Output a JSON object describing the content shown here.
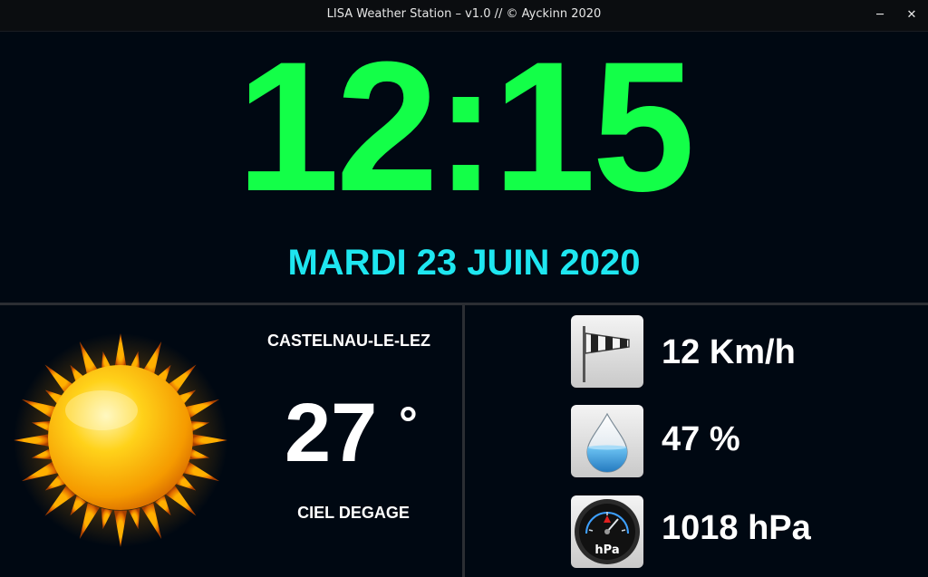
{
  "window": {
    "title": "LISA Weather Station – v1.0 // © Ayckinn 2020",
    "minimize_icon": "minimize-icon",
    "close_icon": "close-icon"
  },
  "clock": {
    "time": "12:15"
  },
  "date": {
    "text": "MARDI 23 JUIN 2020"
  },
  "weather": {
    "city": "CASTELNAU-LE-LEZ",
    "temperature": "27",
    "degree_symbol": "°",
    "condition": "CIEL DEGAGE",
    "icon": "sun-icon"
  },
  "metrics": {
    "wind": {
      "icon": "windsock-icon",
      "value": "12 Km/h"
    },
    "humidity": {
      "icon": "water-drop-icon",
      "value": "47 %"
    },
    "pressure": {
      "icon": "barometer-icon",
      "value": "1018 hPa",
      "icon_label": "hPa"
    }
  },
  "colors": {
    "background": "#000812",
    "clock": "#13ff48",
    "date": "#1ee6f0",
    "text": "#ffffff",
    "divider": "#2b2e33"
  }
}
